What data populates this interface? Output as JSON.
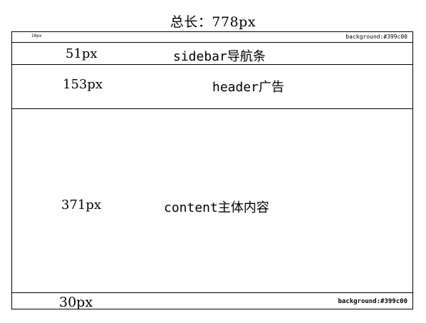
{
  "title": "总长：778px",
  "top_strip": {
    "label_left": "10px",
    "label_right": "background:#399c00"
  },
  "sidebar": {
    "size": "51px",
    "label": "sidebar导航条"
  },
  "header": {
    "size": "153px",
    "label": "header广告"
  },
  "content": {
    "size": "371px",
    "label": "content主体内容"
  },
  "footer": {
    "size": "30px",
    "label_right": "background:#399c00"
  }
}
